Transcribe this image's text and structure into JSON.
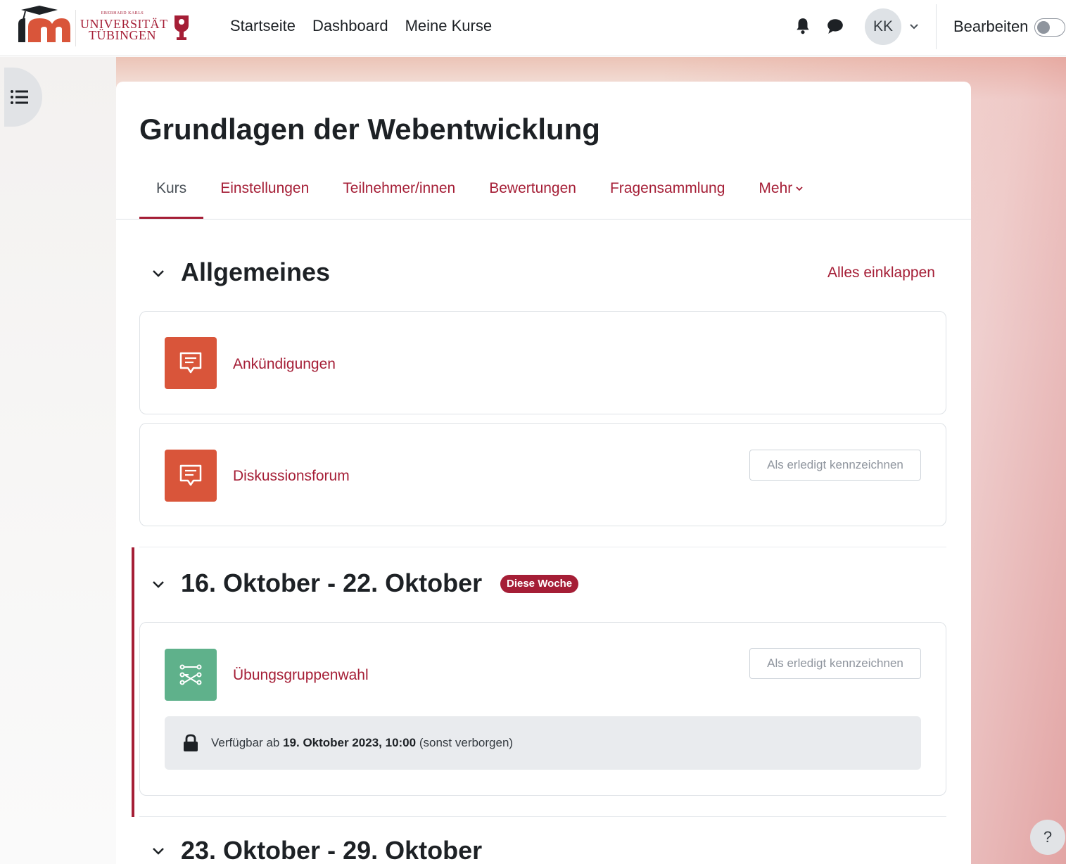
{
  "header": {
    "uni_logo": {
      "small": "EBERHARD KARLS",
      "line1": "UNIVERSITÄT",
      "line2": "TÜBINGEN"
    },
    "nav": [
      "Startseite",
      "Dashboard",
      "Meine Kurse"
    ],
    "avatar_initials": "KK",
    "edit_mode_label": "Bearbeiten",
    "edit_mode_on": false
  },
  "course": {
    "title": "Grundlagen der Webentwicklung",
    "tabs": [
      "Kurs",
      "Einstellungen",
      "Teilnehmer/innen",
      "Bewertungen",
      "Fragensammlung",
      "Mehr"
    ],
    "active_tab": "Kurs"
  },
  "sections": [
    {
      "title": "Allgemeines",
      "collapse_all_label": "Alles einklappen",
      "activities": [
        {
          "name": "Ankündigungen",
          "icon": "forum-icon"
        },
        {
          "name": "Diskussionsforum",
          "icon": "forum-icon",
          "mark_label": "Als erledigt kennzeichnen"
        }
      ]
    },
    {
      "title": "16. Oktober - 22. Oktober",
      "badge": "Diese Woche",
      "activities": [
        {
          "name": "Übungsgruppenwahl",
          "icon": "choice-icon",
          "mark_label": "Als erledigt kennzeichnen",
          "restriction": {
            "prefix": "Verfügbar ab",
            "date": "19. Oktober 2023, 10:00",
            "suffix": "(sonst verborgen)"
          }
        }
      ]
    },
    {
      "title": "23. Oktober - 29. Oktober"
    }
  ],
  "help_label": "?",
  "colors": {
    "accent": "#a51e36",
    "forum": "#d9553a",
    "choice": "#5fb18b"
  }
}
